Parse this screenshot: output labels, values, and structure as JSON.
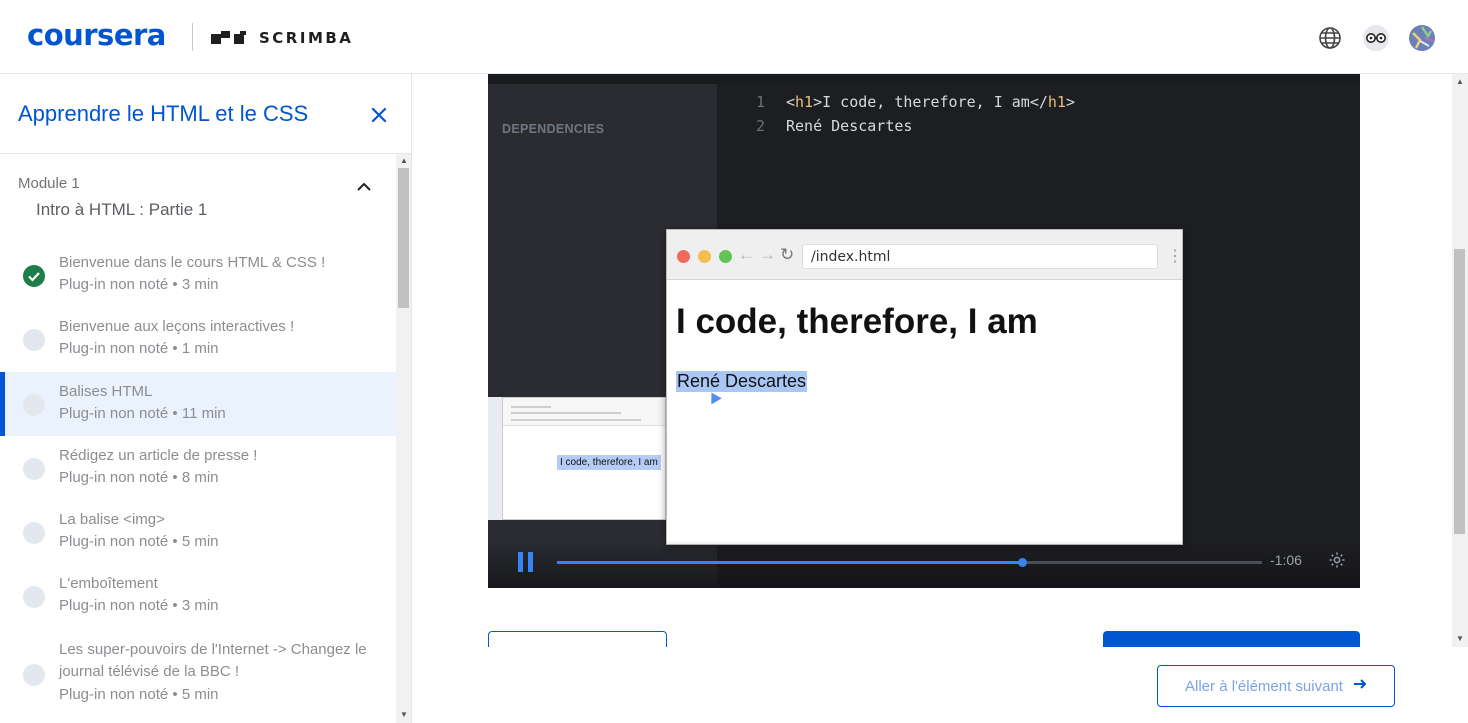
{
  "header": {
    "brand": "coursera",
    "partner": "SCRIMBA",
    "icons": [
      "globe-icon",
      "glasses-icon",
      "avatar"
    ]
  },
  "sidebar": {
    "course_title": "Apprendre le HTML et le CSS",
    "close_icon": "close-icon",
    "module": {
      "label": "Module 1",
      "name": "Intro à HTML : Partie 1",
      "toggle_icon": "chevron-up-icon"
    },
    "items": [
      {
        "title": "Bienvenue dans le cours HTML & CSS !",
        "meta": "Plug-in non noté • 3 min",
        "status": "completed"
      },
      {
        "title": "Bienvenue aux leçons interactives !",
        "meta": "Plug-in non noté • 1 min",
        "status": "not-started"
      },
      {
        "title": "Balises HTML",
        "meta": "Plug-in non noté • 11 min",
        "status": "current"
      },
      {
        "title": "Rédigez un article de presse !",
        "meta": "Plug-in non noté • 8 min",
        "status": "not-started"
      },
      {
        "title": "La balise <img>",
        "meta": "Plug-in non noté • 5 min",
        "status": "not-started"
      },
      {
        "title": "L'emboîtement",
        "meta": "Plug-in non noté • 3 min",
        "status": "not-started"
      },
      {
        "title": "Les super-pouvoirs de l'Internet -> Changez le journal télévisé de la BBC !",
        "meta": "Plug-in non noté • 5 min",
        "status": "not-started"
      }
    ]
  },
  "video": {
    "dependencies_label": "DEPENDENCIES",
    "code_lines": [
      {
        "num": "1",
        "open": "<h1>",
        "text": "I code, therefore, I am",
        "close": "</h1>"
      },
      {
        "num": "2",
        "text": "René Descartes"
      }
    ],
    "browser": {
      "url": "/index.html",
      "heading": "I code, therefore, I am",
      "paragraph": "René Descartes"
    },
    "doc_thumbnail_text": "I code, therefore, I am",
    "progress": 0.66,
    "timecode": "-1:06",
    "accent": "#3a82f7"
  },
  "footer": {
    "next_label": "Aller à l'élément suivant",
    "next_icon": "arrow-right-icon"
  },
  "colors": {
    "brand": "#0056d2",
    "completed": "#1e7d48"
  }
}
